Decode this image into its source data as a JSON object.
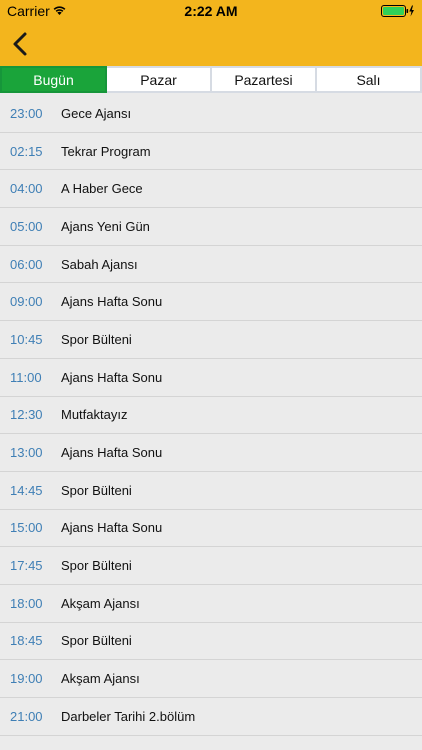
{
  "status_bar": {
    "carrier": "Carrier",
    "time": "2:22 AM",
    "icons": [
      "wifi-icon",
      "battery-icon",
      "charging-bolt-icon"
    ]
  },
  "header": {
    "background_color": "#f3b51d",
    "back_icon": "chevron-left-icon"
  },
  "tabs": [
    {
      "label": "Bugün",
      "active": true
    },
    {
      "label": "Pazar",
      "active": false
    },
    {
      "label": "Pazartesi",
      "active": false
    },
    {
      "label": "Salı",
      "active": false
    }
  ],
  "accent_color": "#1aa43a",
  "time_color": "#3f7fb5",
  "schedule": [
    {
      "time": "23:00",
      "title": "Gece Ajansı"
    },
    {
      "time": "02:15",
      "title": "Tekrar Program"
    },
    {
      "time": "04:00",
      "title": "A Haber Gece"
    },
    {
      "time": "05:00",
      "title": "Ajans Yeni Gün"
    },
    {
      "time": "06:00",
      "title": "Sabah Ajansı"
    },
    {
      "time": "09:00",
      "title": "Ajans Hafta Sonu"
    },
    {
      "time": "10:45",
      "title": "Spor Bülteni"
    },
    {
      "time": "11:00",
      "title": "Ajans Hafta Sonu"
    },
    {
      "time": "12:30",
      "title": "Mutfaktayız"
    },
    {
      "time": "13:00",
      "title": "Ajans Hafta Sonu"
    },
    {
      "time": "14:45",
      "title": "Spor Bülteni"
    },
    {
      "time": "15:00",
      "title": "Ajans Hafta Sonu"
    },
    {
      "time": "17:45",
      "title": "Spor Bülteni"
    },
    {
      "time": "18:00",
      "title": "Akşam Ajansı"
    },
    {
      "time": "18:45",
      "title": "Spor Bülteni"
    },
    {
      "time": "19:00",
      "title": "Akşam Ajansı"
    },
    {
      "time": "21:00",
      "title": "Darbeler Tarihi 2.bölüm"
    }
  ]
}
